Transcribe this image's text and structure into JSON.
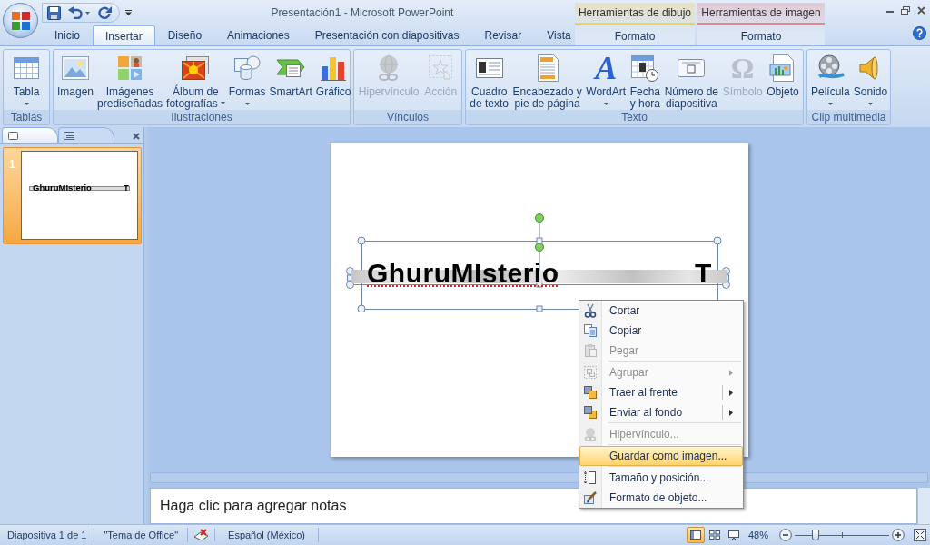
{
  "window": {
    "title": "Presentación1 - Microsoft PowerPoint"
  },
  "tabs": [
    {
      "label": "Inicio",
      "selected": false
    },
    {
      "label": "Insertar",
      "selected": true
    },
    {
      "label": "Diseño",
      "selected": false
    },
    {
      "label": "Animaciones",
      "selected": false
    },
    {
      "label": "Presentación con diapositivas",
      "selected": false
    },
    {
      "label": "Revisar",
      "selected": false
    },
    {
      "label": "Vista",
      "selected": false
    }
  ],
  "contextual_tabs": [
    {
      "title": "Herramientas de dibujo",
      "color": "#f0cf5a",
      "tab": {
        "label": "Formato",
        "selected": false
      }
    },
    {
      "title": "Herramientas de imagen",
      "color": "#e5828f",
      "tab": {
        "label": "Formato",
        "selected": false
      }
    }
  ],
  "ribbon": {
    "groups": [
      {
        "title": "Tablas",
        "buttons": [
          {
            "label": "Tabla",
            "dropdown": true,
            "disabled": false
          }
        ]
      },
      {
        "title": "Ilustraciones",
        "buttons": [
          {
            "label": "Imagen",
            "dropdown": false,
            "disabled": false
          },
          {
            "label": "Imágenes\nprediseñadas",
            "dropdown": false,
            "disabled": false
          },
          {
            "label": "Álbum de\nfotografías",
            "dropdown": true,
            "disabled": false
          },
          {
            "label": "Formas",
            "dropdown": true,
            "disabled": false
          },
          {
            "label": "SmartArt",
            "dropdown": false,
            "disabled": false
          },
          {
            "label": "Gráfico",
            "dropdown": false,
            "disabled": false
          }
        ]
      },
      {
        "title": "Vínculos",
        "buttons": [
          {
            "label": "Hipervínculo",
            "dropdown": false,
            "disabled": true
          },
          {
            "label": "Acción",
            "dropdown": false,
            "disabled": true
          }
        ]
      },
      {
        "title": "Texto",
        "buttons": [
          {
            "label": "Cuadro\nde texto",
            "dropdown": false,
            "disabled": false
          },
          {
            "label": "Encabezado y\npie de página",
            "dropdown": false,
            "disabled": false
          },
          {
            "label": "WordArt",
            "glyph": "A",
            "dropdown": true,
            "disabled": false
          },
          {
            "label": "Fecha\ny hora",
            "dropdown": false,
            "disabled": false
          },
          {
            "label": "Número de\ndiapositiva",
            "dropdown": false,
            "disabled": false
          },
          {
            "label": "Símbolo",
            "glyph": "Ω",
            "dropdown": false,
            "disabled": true
          },
          {
            "label": "Objeto",
            "dropdown": false,
            "disabled": false
          }
        ]
      },
      {
        "title": "Clip multimedia",
        "buttons": [
          {
            "label": "Película",
            "dropdown": true,
            "disabled": false
          },
          {
            "label": "Sonido",
            "dropdown": true,
            "disabled": false
          }
        ]
      }
    ]
  },
  "slides_panel": {
    "tabs": [
      {
        "selected": true
      },
      {
        "selected": false
      }
    ],
    "thumbnails": [
      {
        "number": "1",
        "text": "GhuruMIsterio",
        "end_text": "T",
        "selected": true
      }
    ]
  },
  "slide": {
    "text": "GhuruMIsterio",
    "end_text": "T",
    "spelling_error": true,
    "selected": true
  },
  "notes": {
    "placeholder": "Haga clic para agregar notas"
  },
  "context_menu": {
    "items": [
      {
        "kind": "item",
        "label": "Cortar",
        "disabled": false,
        "submenu": false,
        "split": false,
        "highlighted": false
      },
      {
        "kind": "item",
        "label": "Copiar",
        "disabled": false,
        "submenu": false,
        "split": false,
        "highlighted": false
      },
      {
        "kind": "item",
        "label": "Pegar",
        "disabled": true,
        "submenu": false,
        "split": false,
        "highlighted": false
      },
      {
        "kind": "separator"
      },
      {
        "kind": "item",
        "label": "Agrupar",
        "disabled": true,
        "submenu": true,
        "split": false,
        "highlighted": false
      },
      {
        "kind": "item",
        "label": "Traer al frente",
        "disabled": false,
        "submenu": true,
        "split": true,
        "highlighted": false
      },
      {
        "kind": "item",
        "label": "Enviar al fondo",
        "disabled": false,
        "submenu": true,
        "split": true,
        "highlighted": false
      },
      {
        "kind": "separator"
      },
      {
        "kind": "item",
        "label": "Hipervínculo...",
        "disabled": true,
        "submenu": false,
        "split": false,
        "highlighted": false
      },
      {
        "kind": "separator"
      },
      {
        "kind": "item",
        "label": "Guardar como imagen...",
        "disabled": false,
        "submenu": false,
        "split": false,
        "highlighted": true
      },
      {
        "kind": "separator"
      },
      {
        "kind": "item",
        "label": "Tamaño y posición...",
        "disabled": false,
        "submenu": false,
        "split": false,
        "highlighted": false
      },
      {
        "kind": "item",
        "label": "Formato de objeto...",
        "disabled": false,
        "submenu": false,
        "split": false,
        "highlighted": false
      }
    ]
  },
  "status_bar": {
    "slide_counter": "Diapositiva 1 de 1",
    "theme": "\"Tema de Office\"",
    "language": "Español (México)",
    "views": [
      {
        "selected": true
      },
      {
        "selected": false
      },
      {
        "selected": false
      }
    ],
    "zoom": {
      "reading": "48%",
      "level": 0.22
    }
  }
}
